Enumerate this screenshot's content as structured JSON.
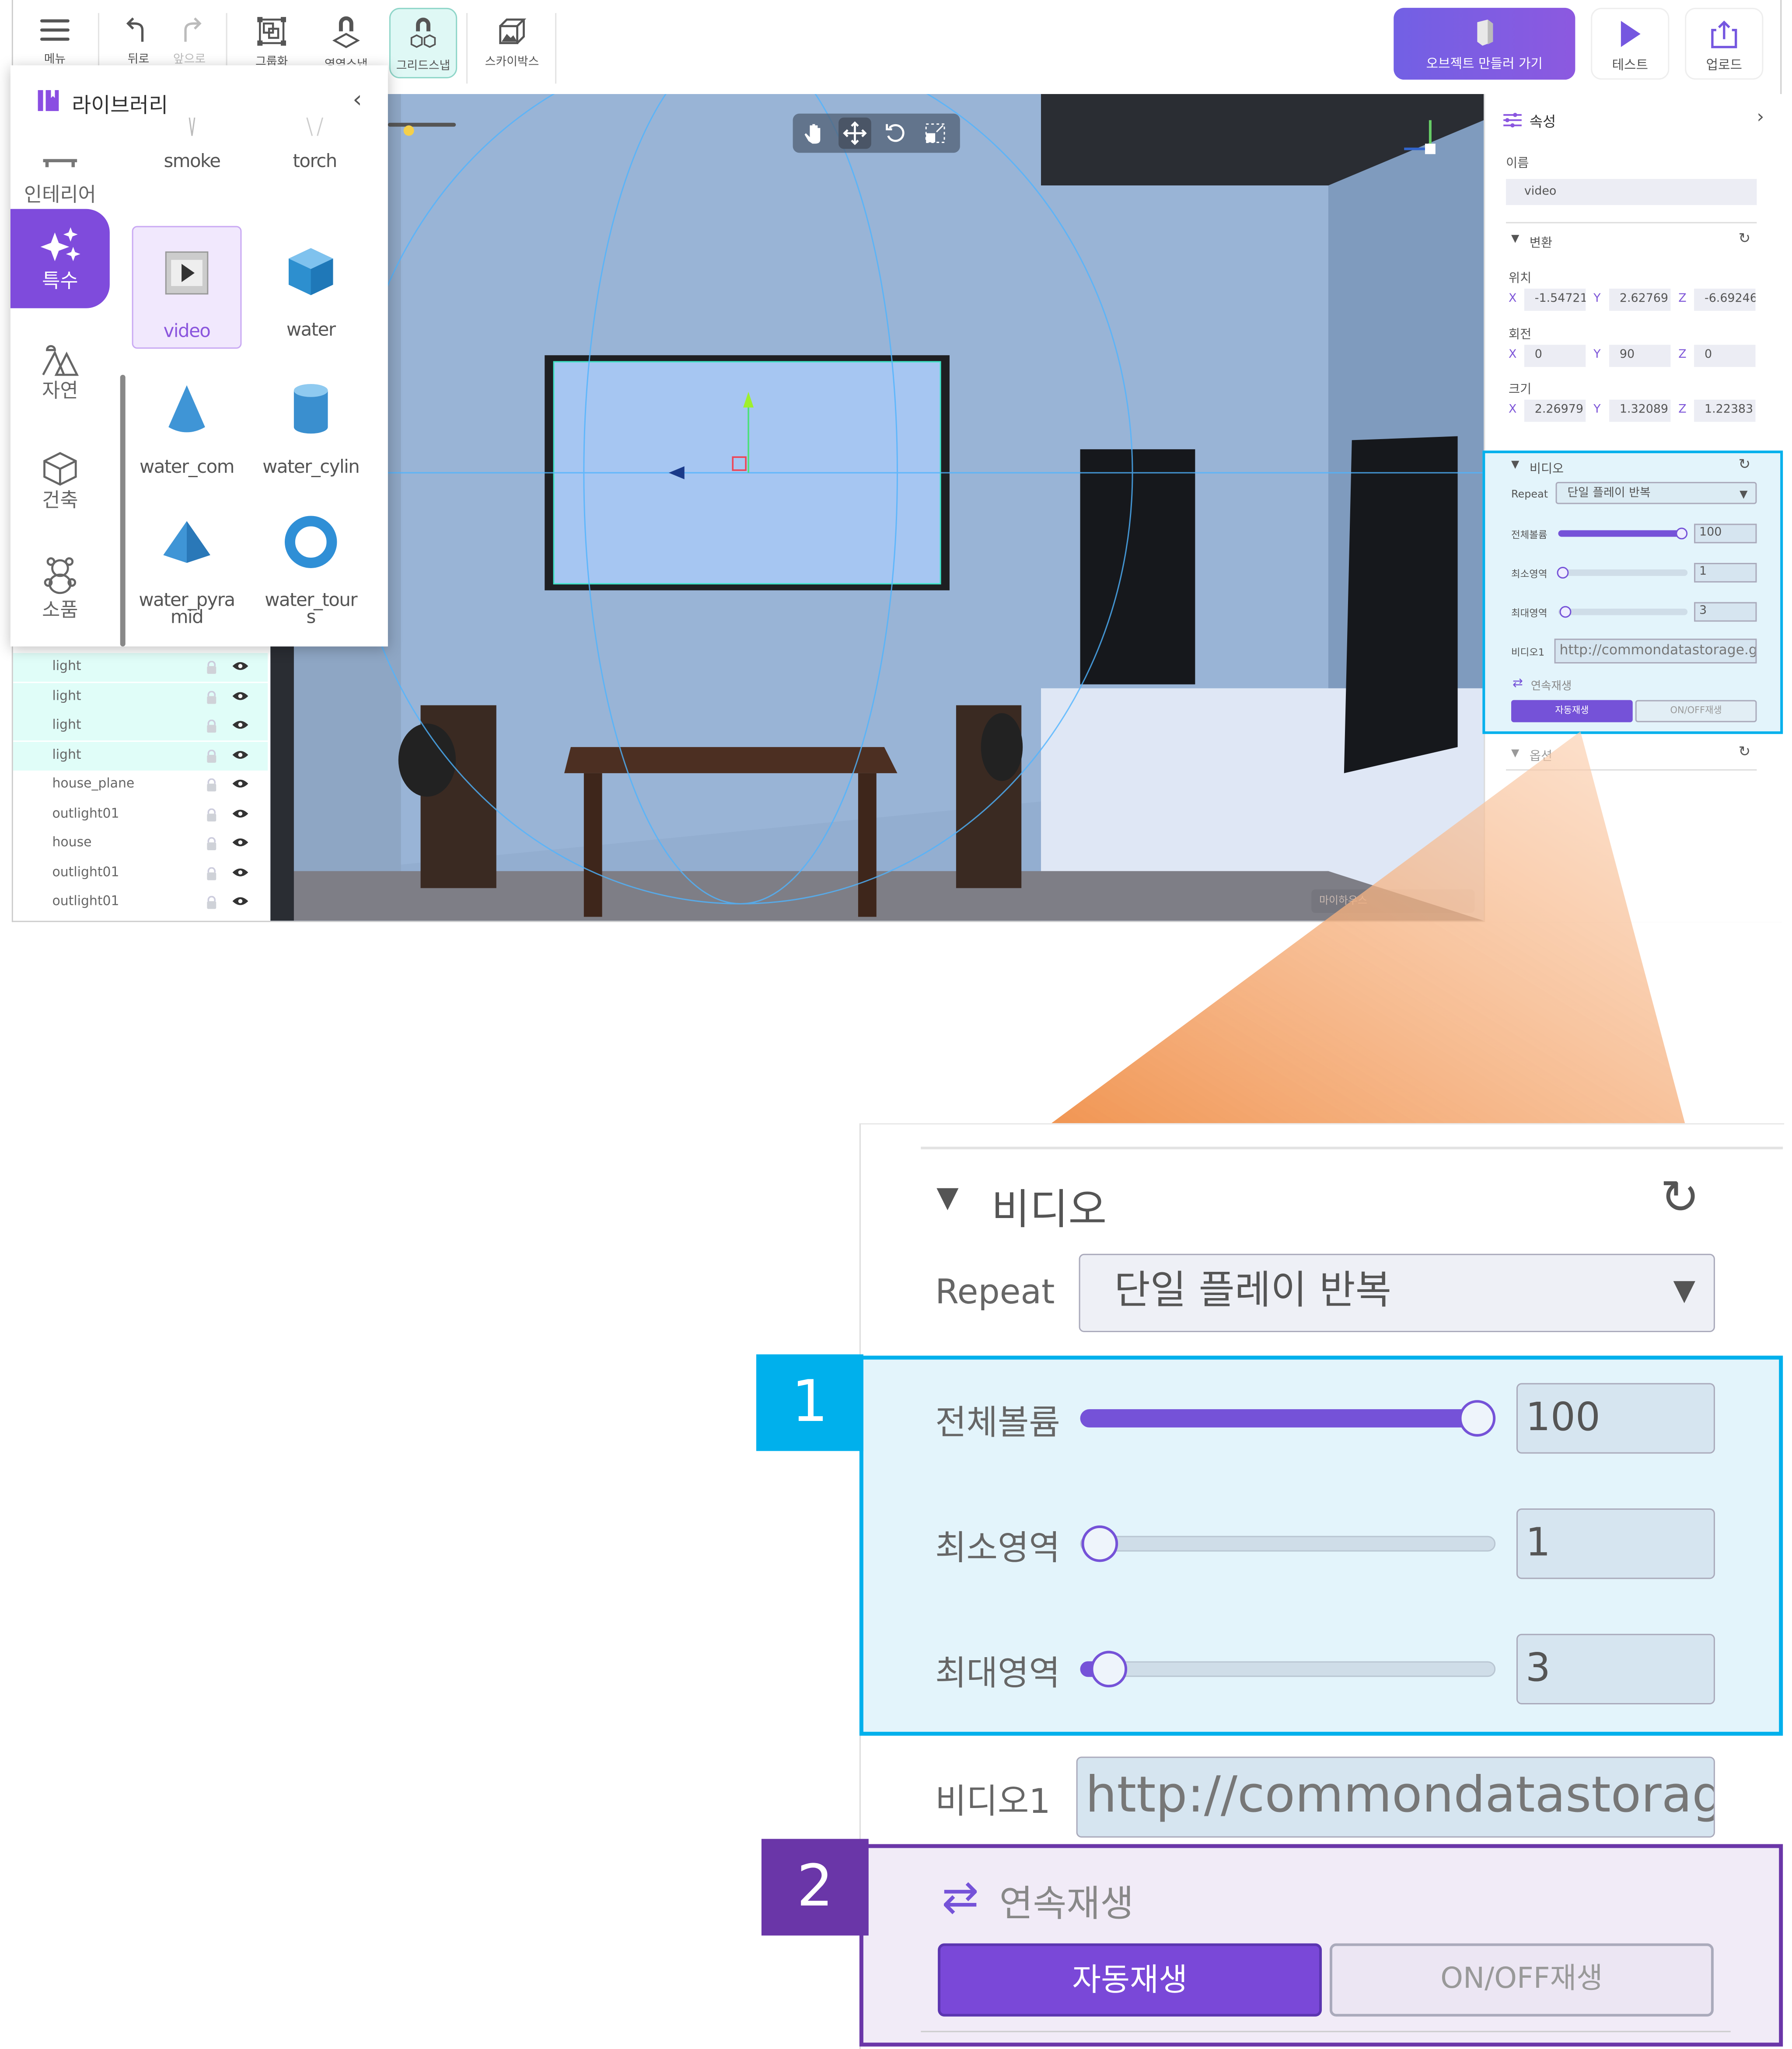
{
  "toolbar": {
    "items": [
      {
        "label": "메뉴",
        "icon": "menu-icon"
      },
      {
        "label": "뒤로",
        "icon": "undo-icon"
      },
      {
        "label": "앞으로",
        "icon": "redo-icon"
      },
      {
        "label": "그룹화",
        "icon": "group-icon"
      },
      {
        "label": "영역스냅",
        "icon": "area-snap-icon"
      },
      {
        "label": "그리드스냅",
        "icon": "grid-snap-icon",
        "active": true
      },
      {
        "label": "스카이박스",
        "icon": "skybox-icon"
      }
    ],
    "create_object": "오브젝트 만들러 가기",
    "test": "테스트",
    "upload": "업로드"
  },
  "library": {
    "title": "라이브러리",
    "categories": [
      {
        "label": "인테리어",
        "icon": "interior-icon"
      },
      {
        "label": "특수",
        "icon": "sparkles-icon",
        "active": true
      },
      {
        "label": "자연",
        "icon": "nature-icon"
      },
      {
        "label": "건축",
        "icon": "architecture-icon"
      },
      {
        "label": "소품",
        "icon": "teddy-bear-icon"
      }
    ],
    "items": [
      {
        "label": "smoke"
      },
      {
        "label": "torch"
      },
      {
        "label": "video",
        "selected": true
      },
      {
        "label": "water"
      },
      {
        "label": "water_com"
      },
      {
        "label": "water_cylin"
      },
      {
        "label": "water_pyra mid"
      },
      {
        "label": "water_tour s"
      }
    ]
  },
  "objects": [
    {
      "name": "light",
      "highlighted": true
    },
    {
      "name": "light",
      "highlighted": true
    },
    {
      "name": "light",
      "highlighted": true
    },
    {
      "name": "light",
      "highlighted": true
    },
    {
      "name": "house_plane"
    },
    {
      "name": "outlight01"
    },
    {
      "name": "house"
    },
    {
      "name": "outlight01"
    },
    {
      "name": "outlight01"
    }
  ],
  "viewport": {
    "tools": [
      "hand-icon",
      "move-icon",
      "rotate-icon",
      "scale-icon"
    ],
    "active_tool": "move-icon",
    "scene_label": "마이하우스"
  },
  "properties": {
    "title": "속성",
    "name_label": "이름",
    "name_value": "video",
    "transform": {
      "title": "변환",
      "position_label": "위치",
      "position": [
        "-1.54721",
        "2.62769",
        "-6.69246"
      ],
      "rotation_label": "회전",
      "rotation": [
        "0",
        "90",
        "0"
      ],
      "scale_label": "크기",
      "scale": [
        "2.26979",
        "1.32089",
        "1.22383"
      ],
      "axes": [
        "X",
        "Y",
        "Z"
      ]
    },
    "video": {
      "title": "비디오",
      "repeat_label": "Repeat",
      "repeat_value": "단일 플레이 반복",
      "volume_label": "전체볼륨",
      "volume": "100",
      "min_label": "최소영역",
      "min": "1",
      "max_label": "최대영역",
      "max": "3",
      "slider_fraction": {
        "volume": 1.0,
        "min": 0.0,
        "max": 0.02
      },
      "video1_label": "비디오1",
      "video1_value": "http://commondatastorage.g",
      "continuous_label": "연속재생",
      "autoplay": "자동재생",
      "onoff": "ON/OFF재생"
    },
    "options_title": "옵션"
  },
  "callouts": {
    "one": "1",
    "two": "2"
  },
  "colors": {
    "accent": "#7c4fdc",
    "callout_blue": "#00b0ec",
    "callout_purple": "#6a36a8",
    "highlight": "#e0fdf8"
  }
}
